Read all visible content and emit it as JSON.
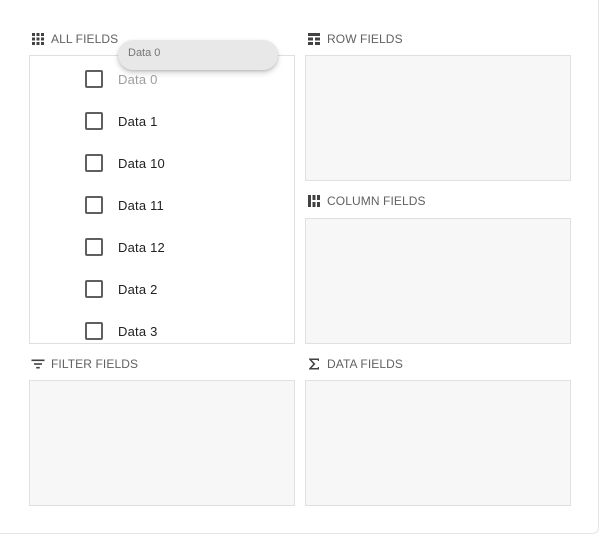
{
  "all_fields": {
    "title": "ALL FIELDS",
    "icon": "grid-icon",
    "items": [
      {
        "label": "Data 0",
        "checked": false,
        "dragging": true
      },
      {
        "label": "Data 1",
        "checked": false
      },
      {
        "label": "Data 10",
        "checked": false
      },
      {
        "label": "Data 11",
        "checked": false
      },
      {
        "label": "Data 12",
        "checked": false
      },
      {
        "label": "Data 2",
        "checked": false
      },
      {
        "label": "Data 3",
        "checked": false
      }
    ]
  },
  "drag_chip": {
    "label": "Data 0"
  },
  "row_fields": {
    "title": "ROW FIELDS",
    "icon": "row-fields-icon"
  },
  "column_fields": {
    "title": "COLUMN FIELDS",
    "icon": "column-fields-icon"
  },
  "filter_fields": {
    "title": "FILTER FIELDS",
    "icon": "filter-icon"
  },
  "data_fields": {
    "title": "DATA FIELDS",
    "icon": "sigma-icon"
  }
}
